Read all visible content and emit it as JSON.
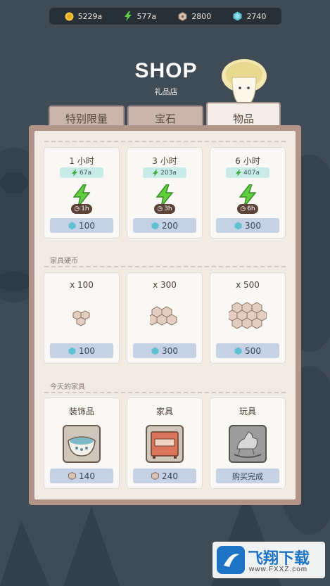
{
  "currencies": [
    {
      "icon": "coin-icon",
      "value": "5229a"
    },
    {
      "icon": "lightning-icon",
      "value": "577a"
    },
    {
      "icon": "furniture-coin-icon",
      "value": "2800"
    },
    {
      "icon": "gem-icon",
      "value": "2740"
    }
  ],
  "header": {
    "title": "SHOP",
    "subtitle": "礼品店"
  },
  "tabs": [
    {
      "label": "特别限量",
      "active": false
    },
    {
      "label": "宝石",
      "active": false
    },
    {
      "label": "物品",
      "active": true
    }
  ],
  "energy_section": {
    "items": [
      {
        "title": "1 小时",
        "bonus": "67a",
        "duration": "1h",
        "price": "100"
      },
      {
        "title": "3 小时",
        "bonus": "203a",
        "duration": "3h",
        "price": "200"
      },
      {
        "title": "6 小时",
        "bonus": "407a",
        "duration": "6h",
        "price": "300"
      }
    ]
  },
  "furniture_coin_section": {
    "label": "家具硬币",
    "items": [
      {
        "title": "x 100",
        "price": "100"
      },
      {
        "title": "x 300",
        "price": "300"
      },
      {
        "title": "x 500",
        "price": "500"
      }
    ]
  },
  "daily_section": {
    "label": "今天的家具",
    "items": [
      {
        "title": "装饰品",
        "price": "140",
        "currency": "furniture-coin-icon"
      },
      {
        "title": "家具",
        "price": "240",
        "currency": "furniture-coin-icon"
      },
      {
        "title": "玩具",
        "price": "购买完成",
        "currency": ""
      }
    ]
  },
  "watermark": {
    "brand": "飞翔下载",
    "url": "www.FXXZ.com"
  },
  "colors": {
    "gem": "#5fc2d3",
    "energy": "#5fcf3f",
    "coin": "#f3c33a",
    "price_button": "#c5d2e5"
  }
}
